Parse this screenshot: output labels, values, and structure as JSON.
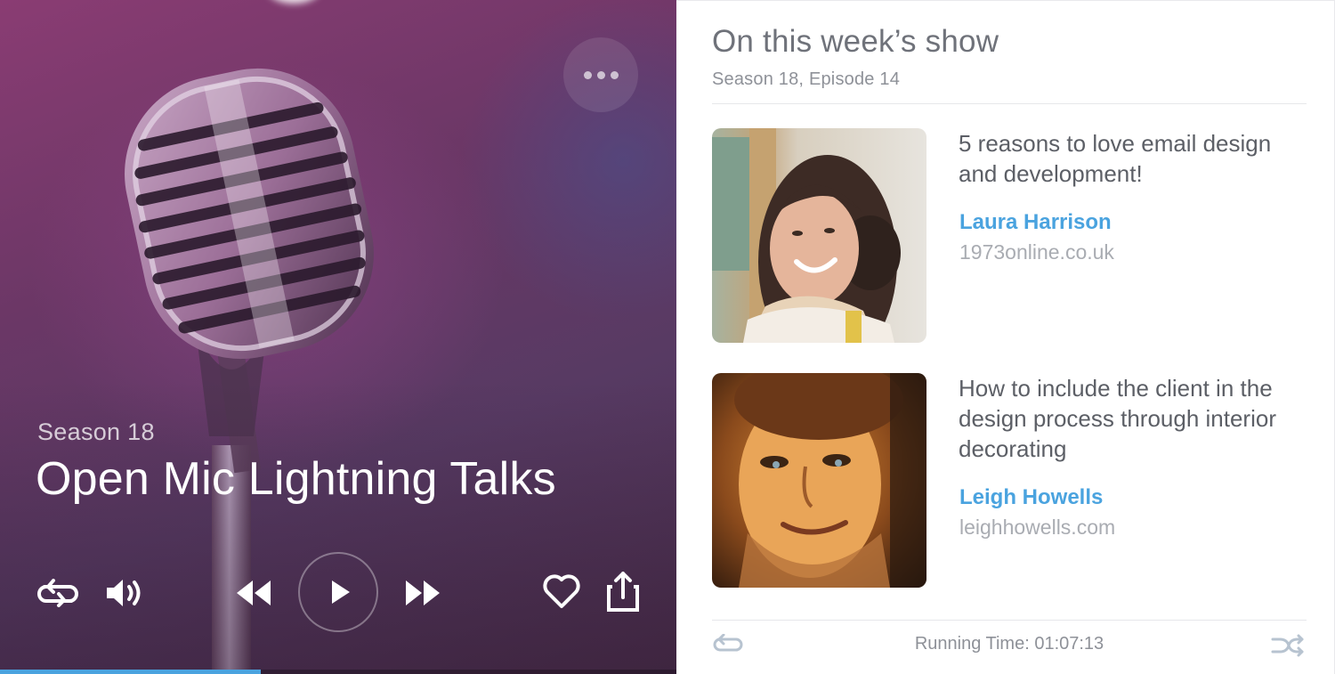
{
  "player": {
    "season": "Season 18",
    "title": "Open Mic Lightning Talks",
    "progress": 0.385,
    "controls": [
      "repeat-icon",
      "volume-icon",
      "rewind-icon",
      "play-icon",
      "fast-forward-icon",
      "heart-icon",
      "share-icon"
    ],
    "more_icon": "more-dots-icon",
    "accent": "#4aa3df"
  },
  "panel": {
    "heading": "On this week’s show",
    "subheading": "Season 18, Episode 14",
    "talks": [
      {
        "title": "5 reasons to love email design and development!",
        "speaker": "Laura Harrison",
        "site": "1973online.co.uk"
      },
      {
        "title": "How to include the client in the design process through interior decorating",
        "speaker": "Leigh Howells",
        "site": "leighhowells.com"
      }
    ],
    "running_time": "Running Time: 01:07:13",
    "footer_icons": [
      "repeat-icon",
      "shuffle-icon"
    ]
  }
}
